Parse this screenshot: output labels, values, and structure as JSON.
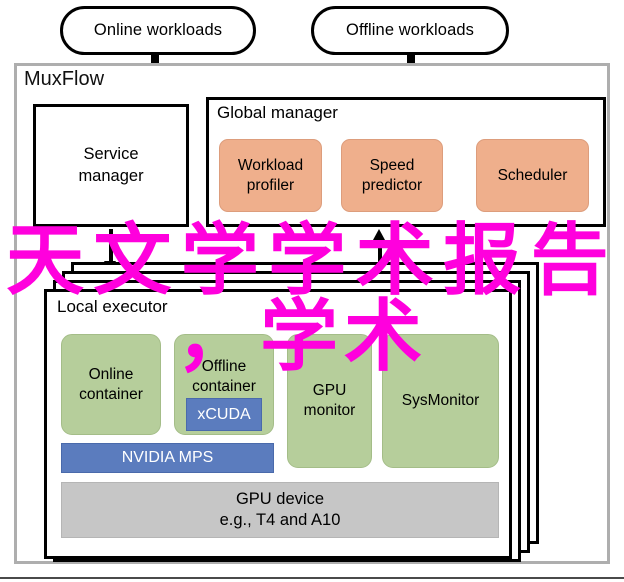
{
  "diagram": {
    "title": "MuxFlow",
    "workload_inputs": [
      {
        "label": "Online workloads"
      },
      {
        "label": "Offline workloads"
      }
    ],
    "service_manager": {
      "label": "Service\nmanager"
    },
    "global_manager": {
      "title": "Global manager",
      "cards": [
        {
          "label": "Workload\nprofiler"
        },
        {
          "label": "Speed\npredictor"
        },
        {
          "label": "Scheduler"
        }
      ]
    },
    "local_executor": {
      "title": "Local executor",
      "containers": [
        {
          "label": "Online\ncontainer"
        },
        {
          "label": "Offline\ncontainer"
        },
        {
          "label": "GPU\nmonitor"
        },
        {
          "label": "SysMonitor"
        }
      ],
      "xcuda_label": "xCUDA",
      "mps_label": "NVIDIA MPS",
      "gpu_device": "GPU device\ne.g., T4 and A10",
      "stack_depth": 3
    }
  },
  "watermark": {
    "line1": "天文学学术报告",
    "line2": "，学术",
    "color": "#ff00dd"
  },
  "colors": {
    "manager_card": "#efaf8c",
    "container_card": "#b6ce9b",
    "blue_box": "#5b7cbe",
    "gpu_device": "#c6c6c6",
    "outer_frame": "#aeaeae",
    "stroke": "#000000"
  }
}
